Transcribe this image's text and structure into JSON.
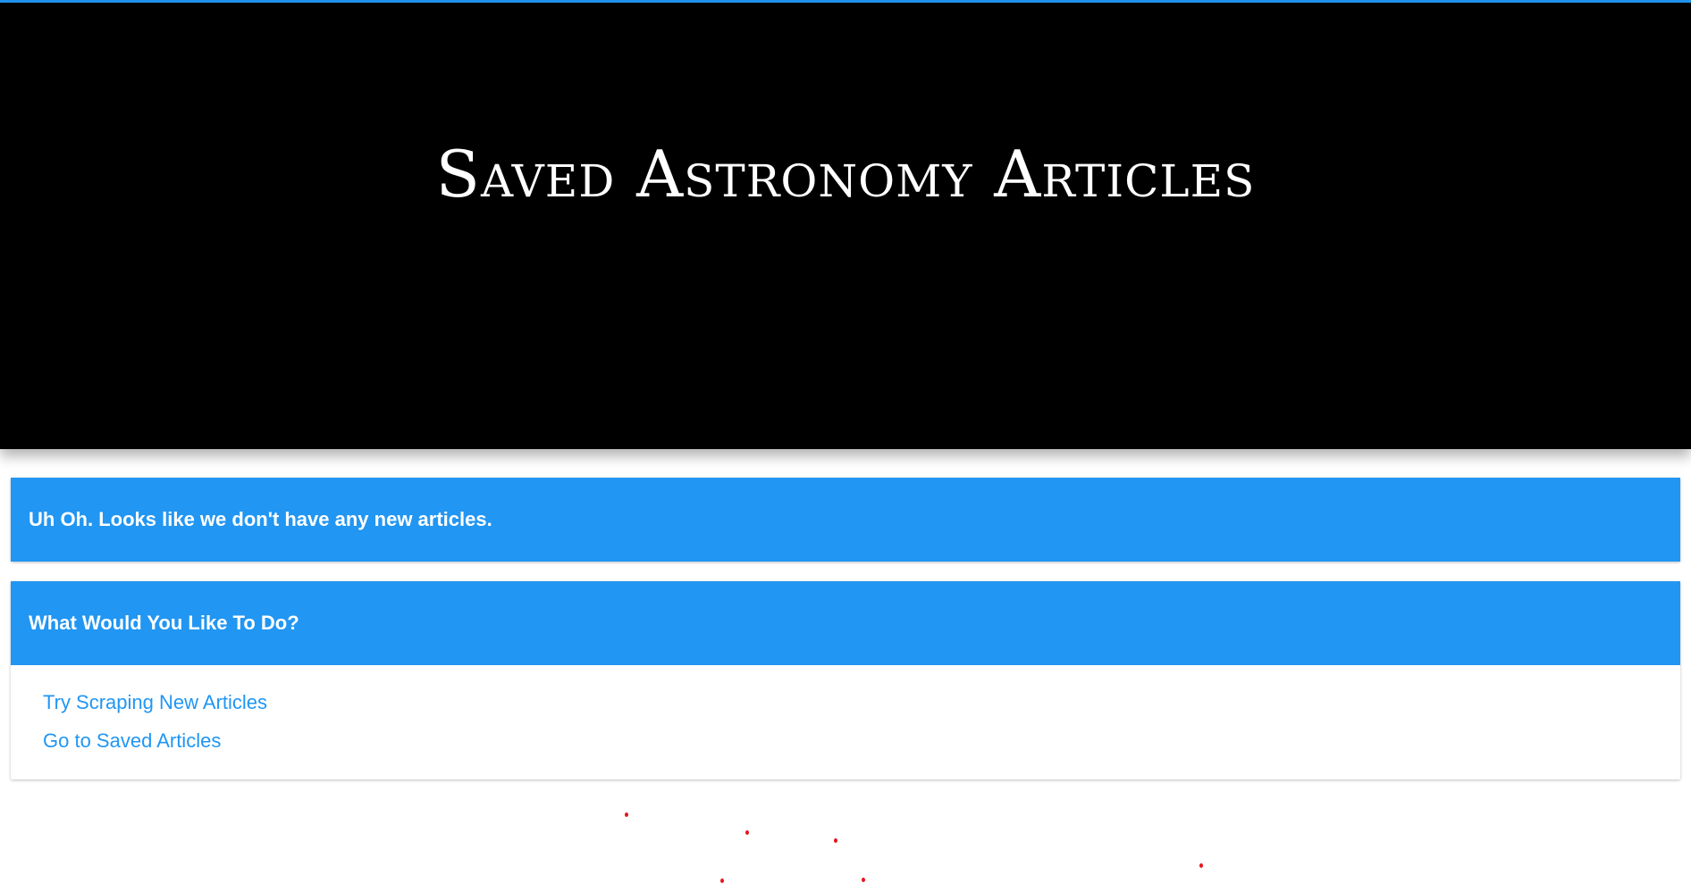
{
  "header": {
    "title": "Saved Astronomy Articles"
  },
  "alert": {
    "message": "Uh Oh. Looks like we don't have any new articles."
  },
  "actions": {
    "title": "What Would You Like To Do?",
    "links": [
      {
        "label": "Try Scraping New Articles"
      },
      {
        "label": "Go to Saved Articles"
      }
    ]
  },
  "colors": {
    "accent": "#2196f3",
    "header_bg": "#000000",
    "dot": "#e8141c"
  }
}
